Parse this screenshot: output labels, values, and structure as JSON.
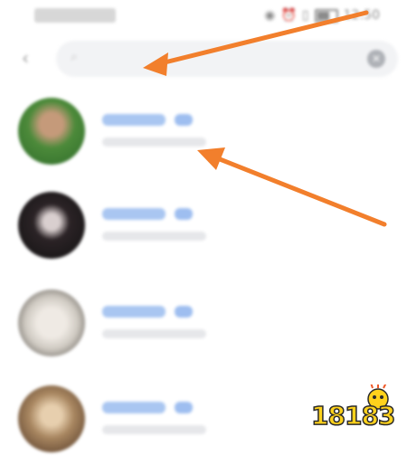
{
  "status_bar": {
    "time": "12:50",
    "icons": [
      "eye-icon",
      "alarm-icon",
      "vibrate-icon",
      "battery-icon"
    ]
  },
  "search": {
    "back_icon": "chevron-left-icon",
    "search_icon": "search-icon",
    "value": "",
    "clear_icon": "close-circle-icon"
  },
  "results": [
    {
      "avatar_color": "#4c8a3a"
    },
    {
      "avatar_color": "#2b2326"
    },
    {
      "avatar_color": "#cfcac2"
    },
    {
      "avatar_color": "#a88660"
    }
  ],
  "annotation_color": "#f27f2c",
  "watermark": {
    "text": "18183",
    "color": "#ffd21c"
  }
}
